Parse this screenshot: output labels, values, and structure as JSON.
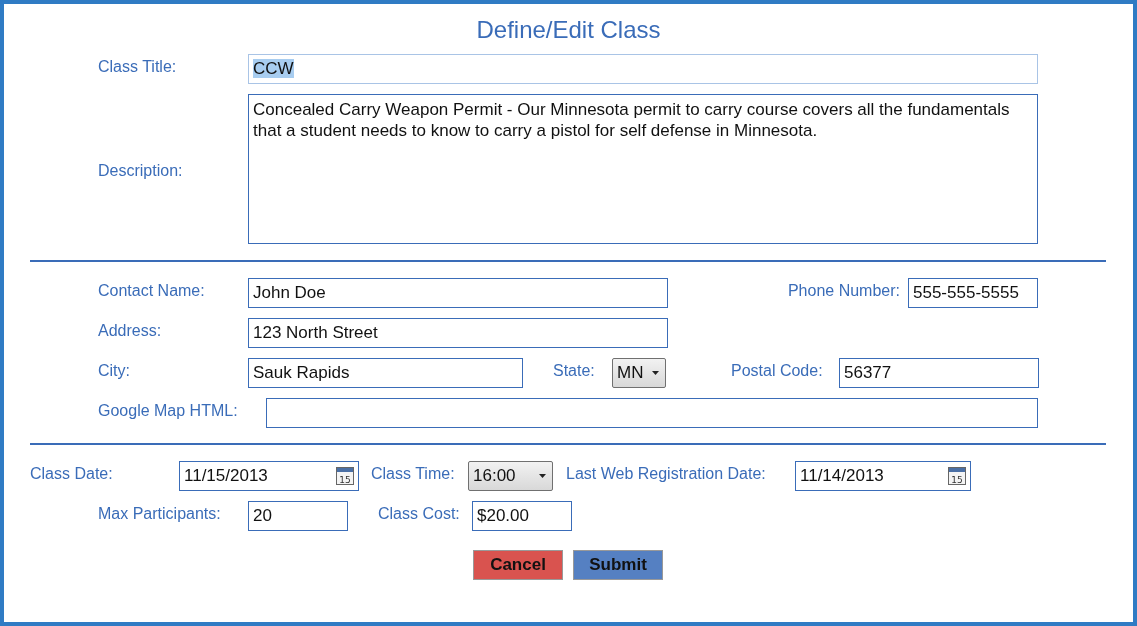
{
  "title": "Define/Edit Class",
  "class_title": {
    "label": "Class Title:",
    "value": "CCW",
    "text_selected": true
  },
  "description": {
    "label": "Description:",
    "value": "Concealed Carry Weapon Permit - Our Minnesota permit to carry course covers all the fundamentals that a student needs to know to carry a pistol for self defense in Minnesota."
  },
  "contact_name": {
    "label": "Contact Name:",
    "value": "John Doe"
  },
  "phone_number": {
    "label": "Phone Number:",
    "value": "555-555-5555"
  },
  "address": {
    "label": "Address:",
    "value": "123 North Street"
  },
  "city": {
    "label": "City:",
    "value": "Sauk Rapids"
  },
  "state": {
    "label": "State:",
    "value": "MN"
  },
  "postal_code": {
    "label": "Postal Code:",
    "value": "56377"
  },
  "google_map_html": {
    "label": "Google Map HTML:"
  },
  "class_date": {
    "label": "Class Date:",
    "value": "11/15/2013",
    "calendar_day": "15"
  },
  "class_time": {
    "label": "Class Time:",
    "value": "16:00"
  },
  "last_web_registration_date": {
    "label": "Last Web Registration Date:",
    "value": "11/14/2013",
    "calendar_day": "15"
  },
  "max_participants": {
    "label": "Max Participants:",
    "value": "20"
  },
  "class_cost": {
    "label": "Class Cost:",
    "value": "$20.00"
  },
  "buttons": [
    {
      "label": "Cancel",
      "kind": "cancel"
    },
    {
      "label": "Submit",
      "kind": "submit"
    }
  ]
}
